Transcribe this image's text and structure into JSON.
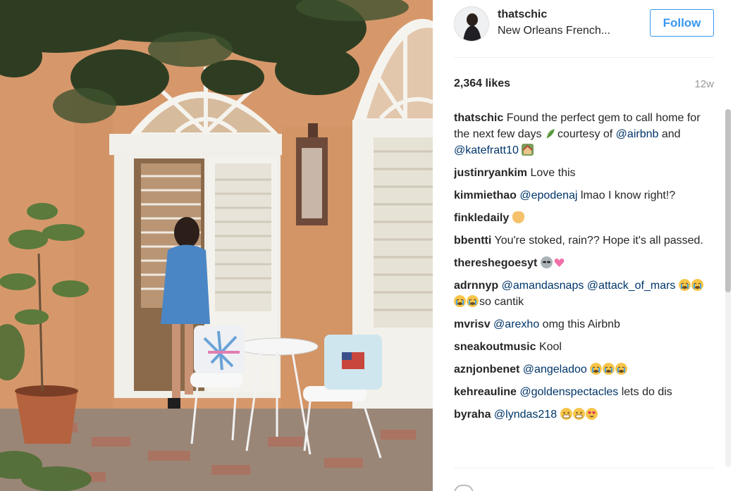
{
  "post": {
    "username": "thatschic",
    "location": "New Orleans French...",
    "follow_label": "Follow",
    "likes": "2,364 likes",
    "age": "12w"
  },
  "comments": [
    {
      "user": "thatschic",
      "parts": [
        {
          "t": "text",
          "v": "Found the perfect gem to call home for the next few days "
        },
        {
          "t": "emoji",
          "name": "herb-emoji"
        },
        {
          "t": "text",
          "v": "courtesy of "
        },
        {
          "t": "mention",
          "v": "@airbnb"
        },
        {
          "t": "text",
          "v": " and "
        },
        {
          "t": "mention",
          "v": "@katefratt10"
        },
        {
          "t": "text",
          "v": " "
        },
        {
          "t": "emoji",
          "name": "house-with-garden-emoji"
        }
      ]
    },
    {
      "user": "justinryankim",
      "parts": [
        {
          "t": "text",
          "v": "Love this"
        }
      ]
    },
    {
      "user": "kimmiethao",
      "parts": [
        {
          "t": "mention",
          "v": "@epodenaj"
        },
        {
          "t": "text",
          "v": " lmao I know right!?"
        }
      ]
    },
    {
      "user": "finkledaily",
      "parts": [
        {
          "t": "emoji",
          "name": "ok-hand-emoji"
        }
      ]
    },
    {
      "user": "bbentti",
      "parts": [
        {
          "t": "text",
          "v": "You're stoked, rain?? Hope it's all passed."
        }
      ]
    },
    {
      "user": "thereshegoesyt",
      "parts": [
        {
          "t": "emoji",
          "name": "alien-emoji"
        },
        {
          "t": "emoji",
          "name": "sparkling-heart-emoji"
        }
      ]
    },
    {
      "user": "adrnnyp",
      "parts": [
        {
          "t": "mention",
          "v": "@amandasnaps"
        },
        {
          "t": "text",
          "v": " "
        },
        {
          "t": "mention",
          "v": "@attack_of_mars"
        },
        {
          "t": "text",
          "v": " "
        },
        {
          "t": "emoji",
          "name": "crying-face-emoji"
        },
        {
          "t": "emoji",
          "name": "crying-face-emoji"
        },
        {
          "t": "emoji",
          "name": "crying-face-emoji"
        },
        {
          "t": "emoji",
          "name": "crying-face-emoji"
        },
        {
          "t": "text",
          "v": "so cantik"
        }
      ]
    },
    {
      "user": "mvrisv",
      "parts": [
        {
          "t": "mention",
          "v": "@arexho"
        },
        {
          "t": "text",
          "v": " omg this Airbnb"
        }
      ]
    },
    {
      "user": "sneakoutmusic",
      "parts": [
        {
          "t": "text",
          "v": "Kool"
        }
      ]
    },
    {
      "user": "aznjonbenet",
      "parts": [
        {
          "t": "mention",
          "v": "@angeladoo"
        },
        {
          "t": "text",
          "v": " "
        },
        {
          "t": "emoji",
          "name": "crying-face-emoji"
        },
        {
          "t": "emoji",
          "name": "crying-face-emoji"
        },
        {
          "t": "emoji",
          "name": "crying-face-emoji"
        }
      ]
    },
    {
      "user": "kehreauline",
      "parts": [
        {
          "t": "mention",
          "v": "@goldenspectacles"
        },
        {
          "t": "text",
          "v": " lets do dis"
        }
      ]
    },
    {
      "user": "byraha",
      "parts": [
        {
          "t": "mention",
          "v": "@lyndas218"
        },
        {
          "t": "text",
          "v": " "
        },
        {
          "t": "emoji",
          "name": "grimacing-face-emoji"
        },
        {
          "t": "emoji",
          "name": "grimacing-face-emoji"
        },
        {
          "t": "emoji",
          "name": "heart-eyes-emoji"
        }
      ]
    }
  ],
  "colors": {
    "follow_blue": "#3897f0",
    "mention_blue": "#003569",
    "wall": "#d99b6e",
    "muted": "#999999"
  }
}
